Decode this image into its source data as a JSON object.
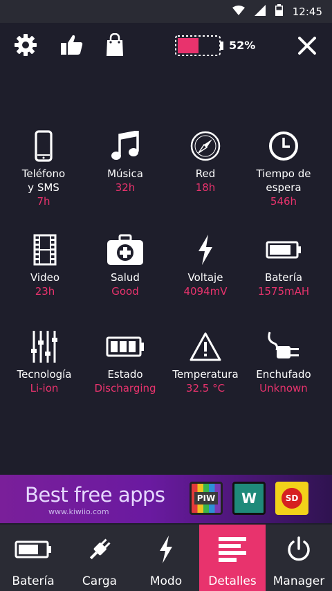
{
  "status_bar": {
    "time": "12:45"
  },
  "top_bar": {
    "battery_percent_label": "52%",
    "battery_level": 0.52,
    "accent": "#e8336d"
  },
  "stats": [
    {
      "label": "Teléfono\ny SMS",
      "value": "7h",
      "icon": "phone-icon"
    },
    {
      "label": "Música",
      "value": "32h",
      "icon": "music-icon"
    },
    {
      "label": "Red",
      "value": "18h",
      "icon": "compass-icon"
    },
    {
      "label": "Tiempo de\nespera",
      "value": "546h",
      "icon": "clock-icon"
    },
    {
      "label": "Video",
      "value": "23h",
      "icon": "film-icon"
    },
    {
      "label": "Salud",
      "value": "Good",
      "icon": "health-kit-icon"
    },
    {
      "label": "Voltaje",
      "value": "4094mV",
      "icon": "lightning-icon"
    },
    {
      "label": "Batería",
      "value": "1575mAH",
      "icon": "battery-icon"
    },
    {
      "label": "Tecnología",
      "value": "Li-ion",
      "icon": "sliders-icon"
    },
    {
      "label": "Estado",
      "value": "Discharging",
      "icon": "battery-full-icon"
    },
    {
      "label": "Temperatura",
      "value": "32.5 °C",
      "icon": "warning-icon"
    },
    {
      "label": "Enchufado",
      "value": "Unknown",
      "icon": "plug-icon"
    }
  ],
  "ad": {
    "title": "Best free apps",
    "url": "www.kiwiio.com",
    "apps": [
      "PIW",
      "W",
      "SD"
    ]
  },
  "nav": [
    {
      "label": "Batería",
      "icon": "battery-icon",
      "active": false
    },
    {
      "label": "Carga",
      "icon": "plug-icon",
      "active": false
    },
    {
      "label": "Modo",
      "icon": "lightning-icon",
      "active": false
    },
    {
      "label": "Detalles",
      "icon": "list-icon",
      "active": true
    },
    {
      "label": "Manager",
      "icon": "power-icon",
      "active": false
    }
  ]
}
